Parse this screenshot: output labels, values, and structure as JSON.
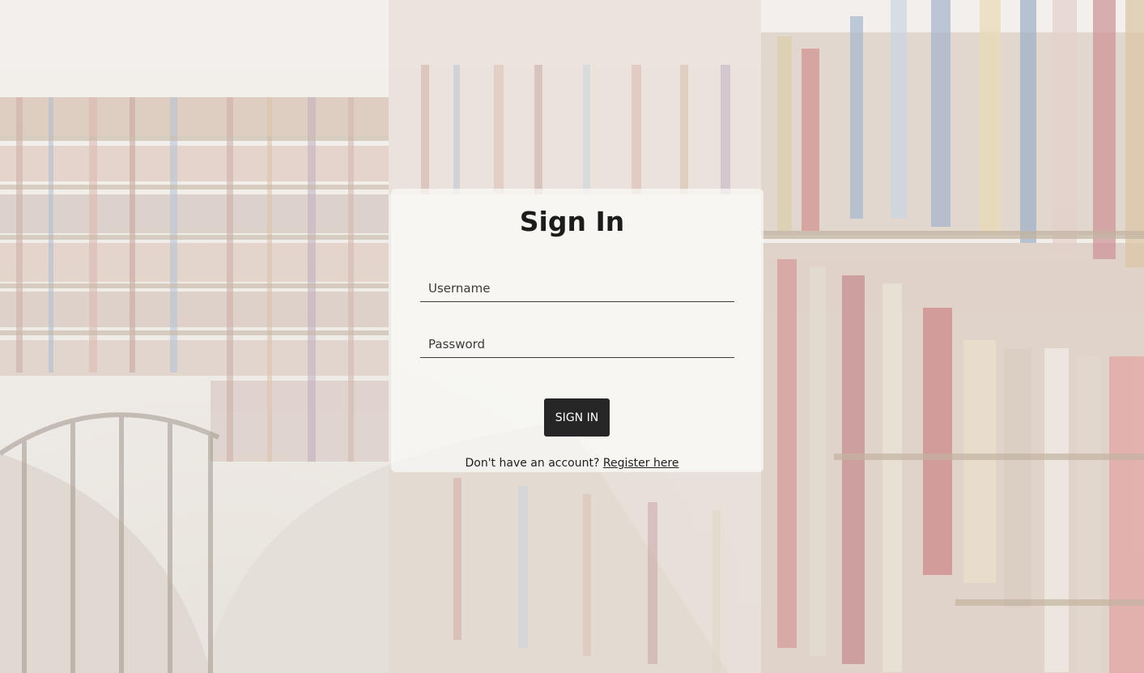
{
  "signin": {
    "title": "Sign In",
    "username_placeholder": "Username",
    "password_placeholder": "Password",
    "button_label": "SIGN IN",
    "register_prompt": "Don't have an account?",
    "register_link": "Register here"
  },
  "background": {
    "image": "library-bookshelves-photo"
  },
  "colors": {
    "button_bg": "#262626",
    "button_text": "#ffffff",
    "text": "#1c1c1c"
  }
}
